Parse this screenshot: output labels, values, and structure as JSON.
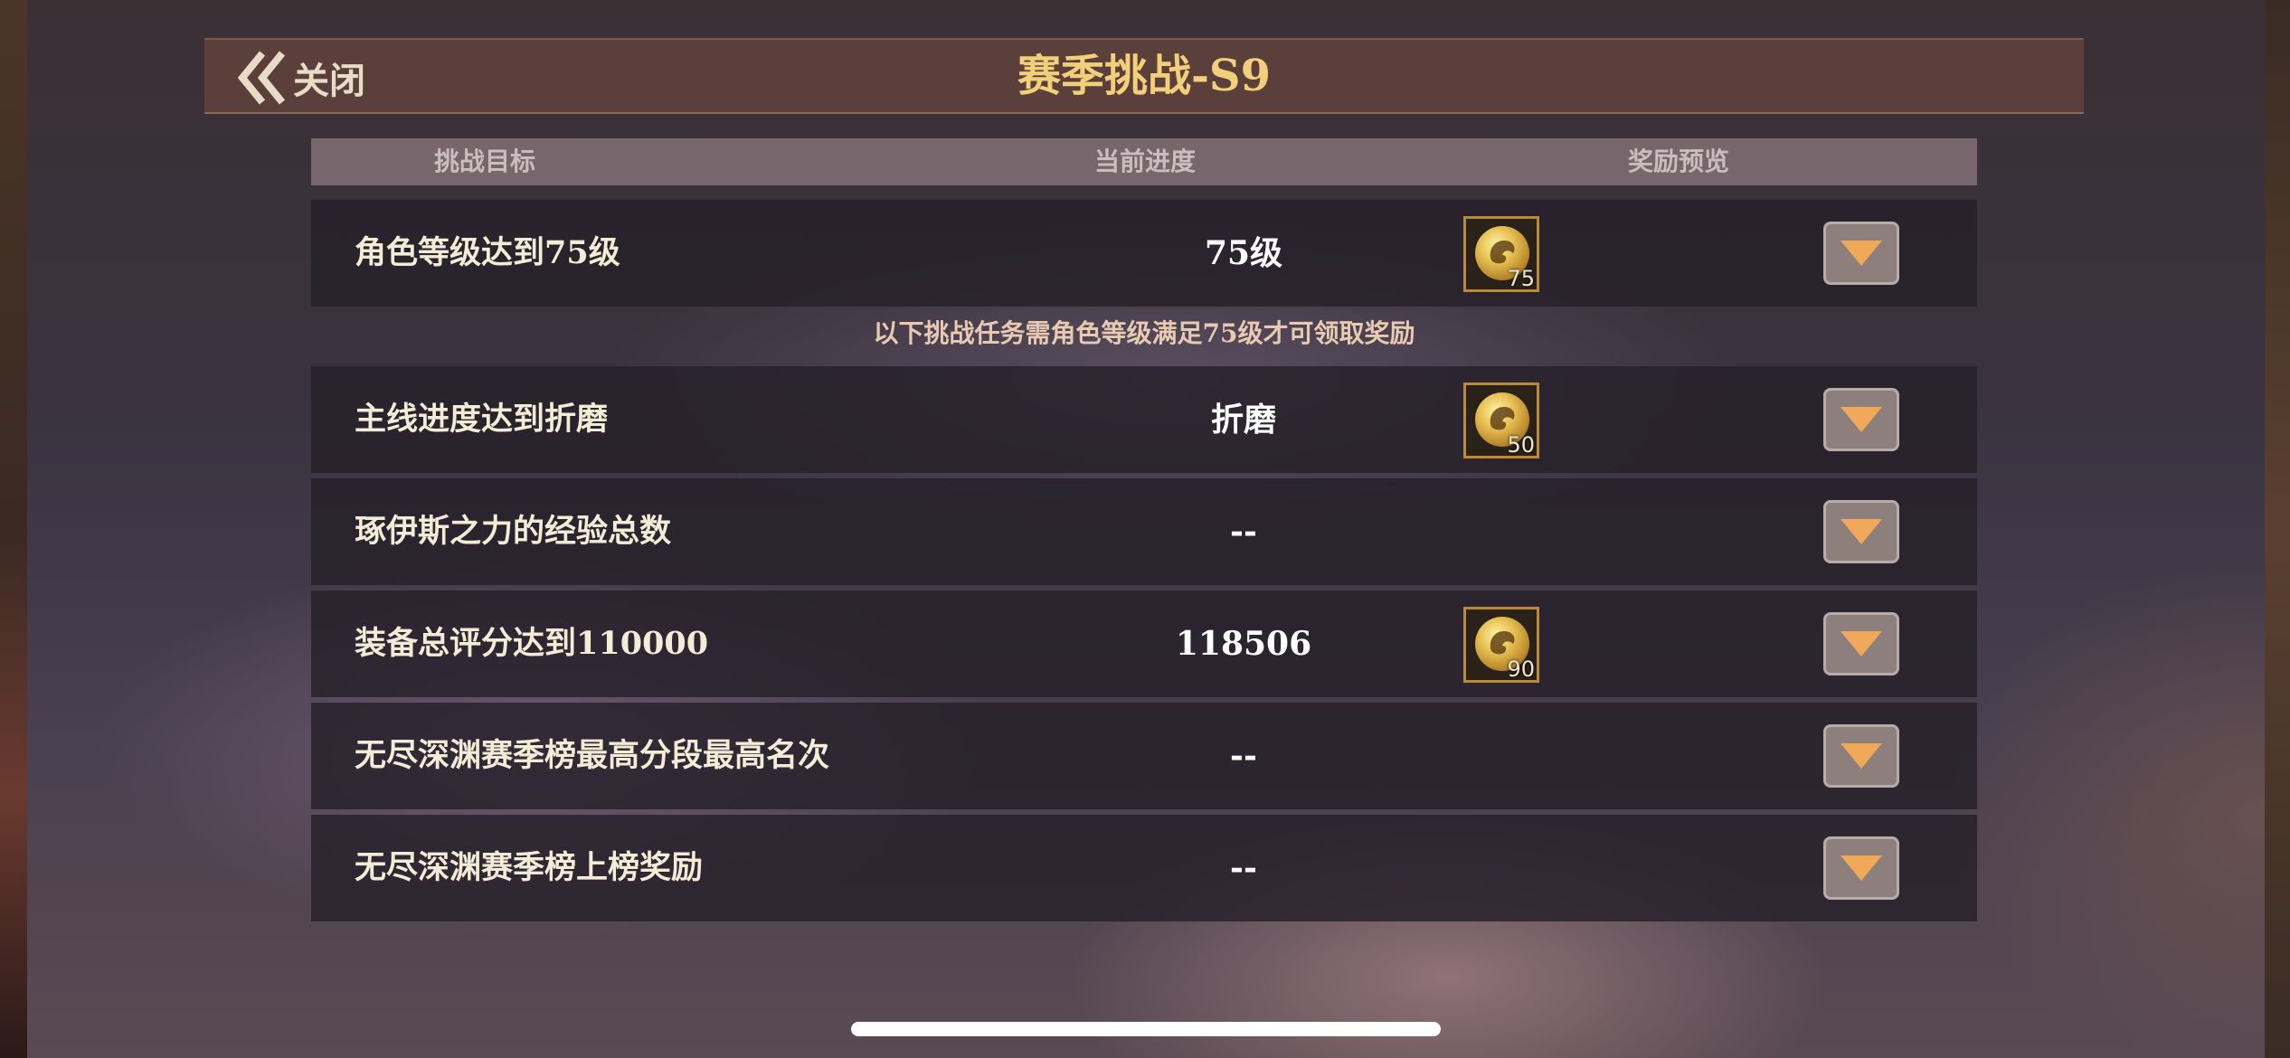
{
  "header": {
    "close_label": "关闭",
    "title": "赛季挑战-S9"
  },
  "columns": {
    "target": "挑战目标",
    "progress": "当前进度",
    "reward": "奖励预览"
  },
  "notice": "以下挑战任务需角色等级满足75级才可领取奖励",
  "rows": [
    {
      "label": "角色等级达到75级",
      "progress": "75级",
      "reward_count": "75"
    },
    {
      "label": "主线进度达到折磨",
      "progress": "折磨",
      "reward_count": "50"
    },
    {
      "label": "琢伊斯之力的经验总数",
      "progress": "--"
    },
    {
      "label": "装备总评分达到110000",
      "progress": "118506",
      "reward_count": "90"
    },
    {
      "label": "无尽深渊赛季榜最高分段最高名次",
      "progress": "--"
    },
    {
      "label": "无尽深渊赛季榜上榜奖励",
      "progress": "--"
    }
  ],
  "icons": {
    "close": "double-chevron-left-icon",
    "reward": "gold-coin-icon",
    "expand": "triangle-down-icon"
  },
  "colors": {
    "header_bg": "#5b3f3a",
    "title": "#f2cf7a",
    "expand_arrow": "#f0a85a",
    "reward_border": "#b88a3a"
  }
}
